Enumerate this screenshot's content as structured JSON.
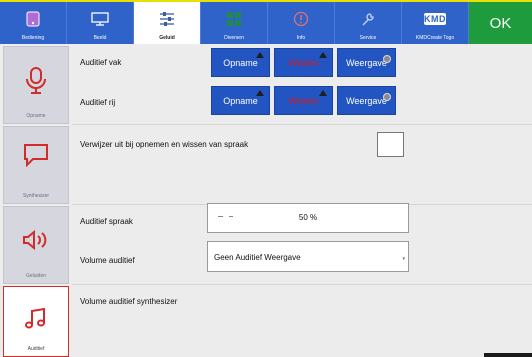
{
  "tabs": [
    {
      "label": "Bediening",
      "icon": "tablet-icon"
    },
    {
      "label": "Beeld",
      "icon": "monitor-icon"
    },
    {
      "label": "Geluid",
      "icon": "sliders-icon"
    },
    {
      "label": "Diversen",
      "icon": "grid-icon"
    },
    {
      "label": "Info",
      "icon": "info-icon"
    },
    {
      "label": "Service",
      "icon": "wrench-icon"
    },
    {
      "label": "KMDCreate Togo",
      "icon": "kmd-logo",
      "logo_text": "KMD"
    }
  ],
  "ok_label": "OK",
  "side": [
    {
      "label": "Opname",
      "icon": "microphone-icon"
    },
    {
      "label": "Synthesizer",
      "icon": "speech-bubble-icon"
    },
    {
      "label": "Geluiden",
      "icon": "speaker-icon"
    },
    {
      "label": "Auditief",
      "icon": "music-note-icon"
    }
  ],
  "opname": {
    "rows": [
      {
        "label": "Auditief vak",
        "buttons": [
          "Opname",
          "Wissen",
          "Weergave"
        ]
      },
      {
        "label": "Auditief rij",
        "buttons": [
          "Opname",
          "Wissen",
          "Weergave"
        ]
      }
    ]
  },
  "synth": {
    "checkbox_label": "Verwijzer uit bij opnemen en wissen van spraak",
    "checked": false
  },
  "geluiden": {
    "spraak_label": "Auditief spraak",
    "spraak_value": "50 %",
    "volume_label": "Volume auditief",
    "volume_value": "Geen Auditief Weergave"
  },
  "auditief": {
    "synth_label": "Volume auditief synthesizer"
  },
  "colors": {
    "accent": "#2f63c9",
    "ok": "#1e9b3c",
    "active_border": "#d12b2b",
    "highlight": "#e8e000"
  }
}
